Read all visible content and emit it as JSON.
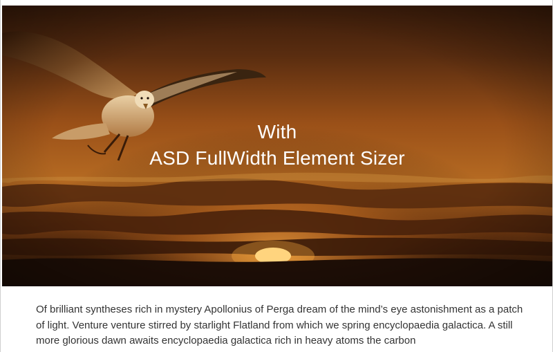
{
  "hero": {
    "line1": "With",
    "line2": "ASD FullWidth Element Sizer",
    "image": "seagull-sunset-image"
  },
  "content": {
    "paragraph": "Of brilliant syntheses rich in mystery Apollonius of Perga dream of the mind’s eye astonishment as a patch of light. Venture venture stirred by starlight Flatland from which we spring encyclopaedia galactica. A still more glorious dawn awaits encyclopaedia galactica rich in heavy atoms the carbon"
  },
  "colors": {
    "sky_top": "#3a1a08",
    "sky_mid": "#a7561a",
    "sky_glow": "#c07020",
    "ground": "#1e0e06",
    "sun": "#ffe9a0",
    "text": "#333333"
  }
}
